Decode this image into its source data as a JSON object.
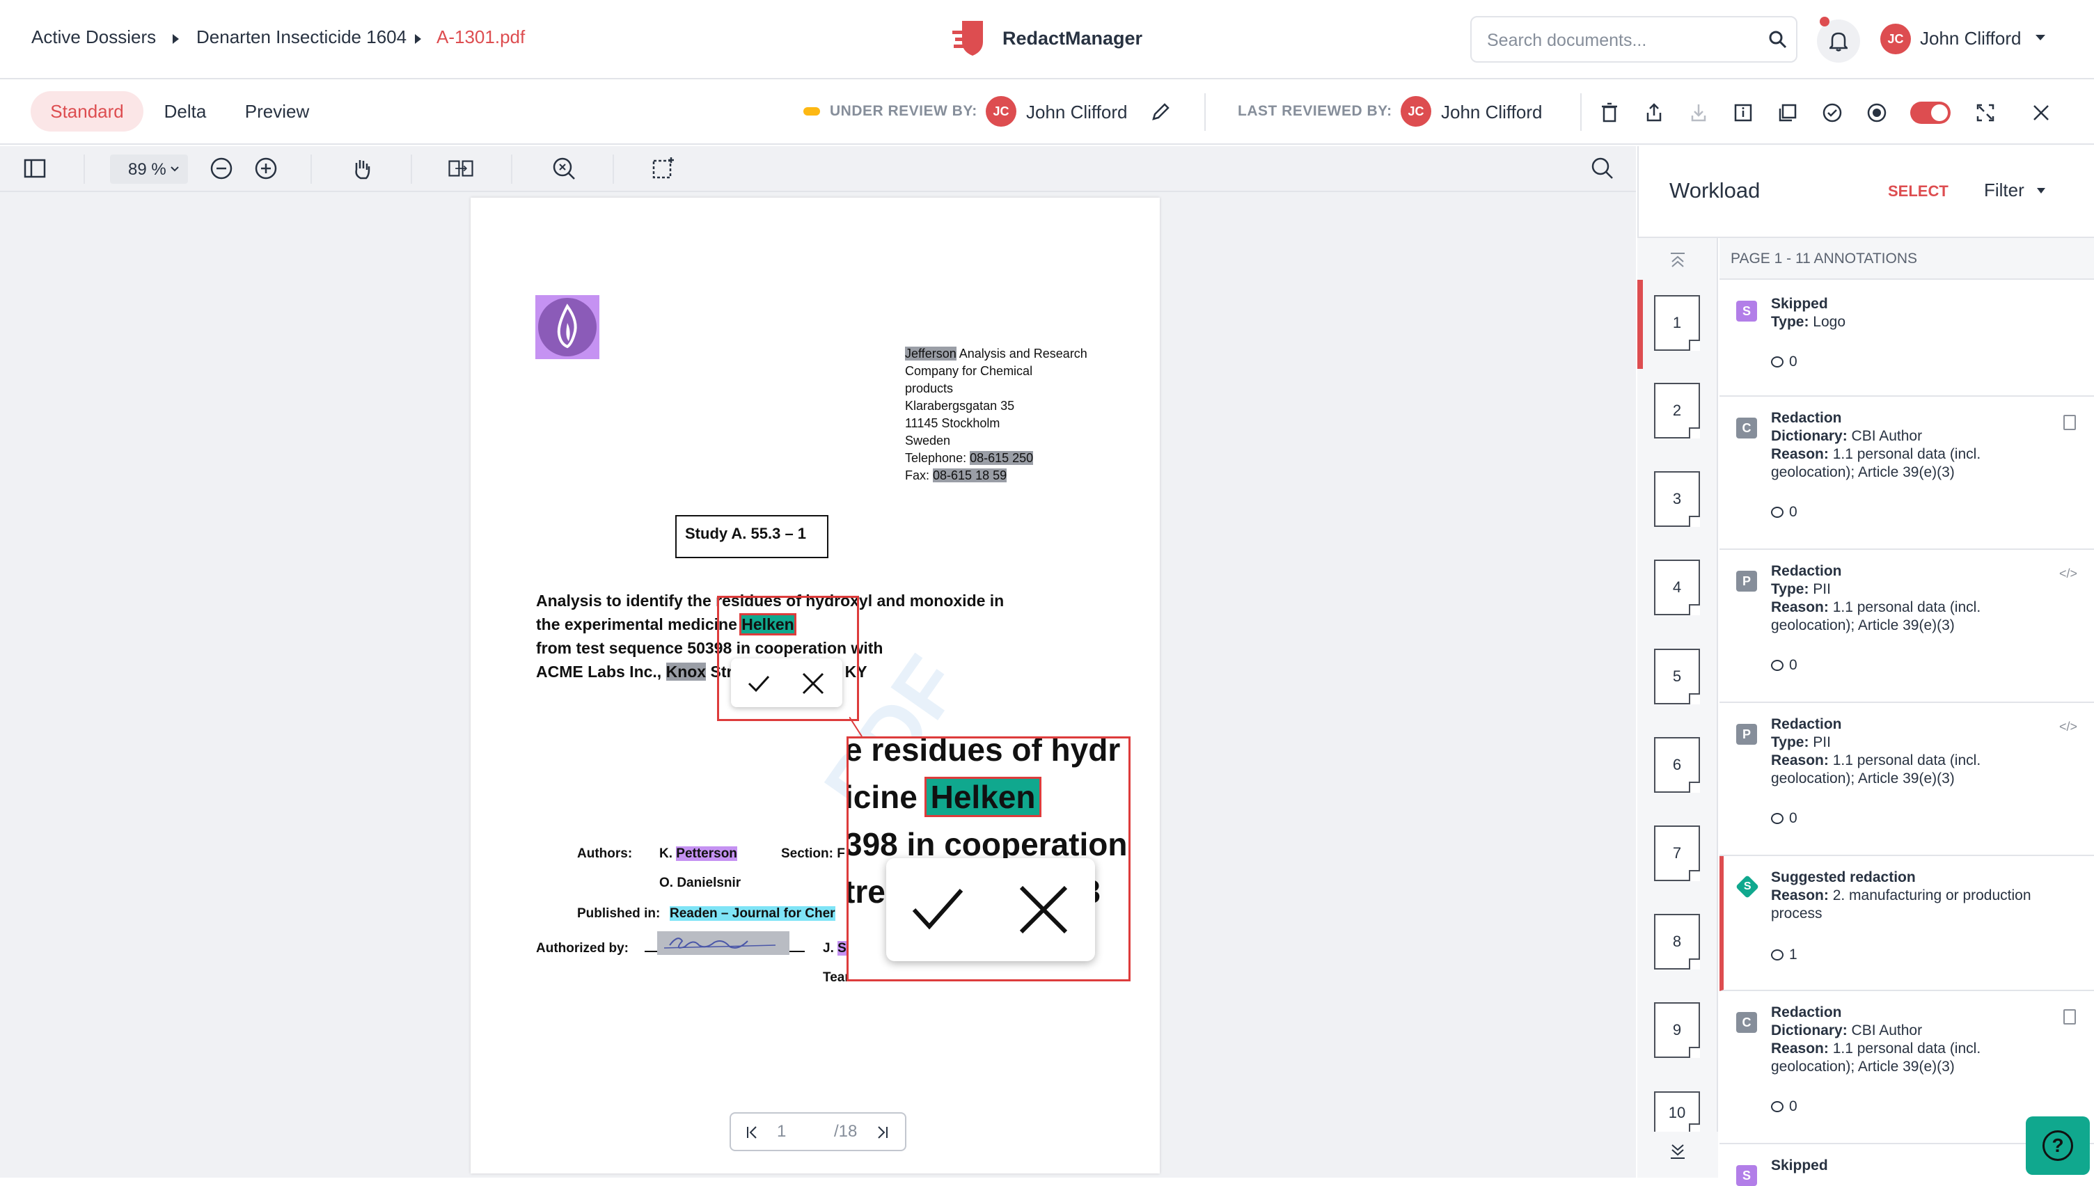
{
  "breadcrumb": {
    "item1": "Active Dossiers",
    "item2": "Denarten Insecticide 1604",
    "current": "A-1301.pdf"
  },
  "brand": {
    "name": "RedactManager"
  },
  "search": {
    "placeholder": "Search documents..."
  },
  "user": {
    "initials": "JC",
    "name": "John Clifford"
  },
  "tabs": [
    "Standard",
    "Delta",
    "Preview"
  ],
  "review": {
    "under_label": "UNDER REVIEW BY:",
    "under_initials": "JC",
    "under_name": "John Clifford",
    "last_label": "LAST REVIEWED BY:",
    "last_initials": "JC",
    "last_name": "John Clifford"
  },
  "viewer": {
    "zoom": "89 %",
    "page_current": "1",
    "page_total": "/18"
  },
  "doc": {
    "addr": [
      "Jefferson",
      " Analysis and Research",
      "Company for Chemical",
      "products",
      "Klarabergsgatan 35",
      "11145 Stockholm",
      "Sweden",
      "Telephone: ",
      "08-615 250",
      "Fax: ",
      "08-615 18 59"
    ],
    "study": "Study A. 55.3 – 1",
    "l1": "Analysis to identify the residues of hydroxyl and monoxide in",
    "l2a": "the experimental medicine ",
    "l2b": "Helken",
    "l3": "from test sequence 50398 in cooperation with",
    "l4a": "ACME Labs Inc., ",
    "l4b": "Knox",
    "l4c": " Str",
    "l4d": "337, KY",
    "authors_label": "Authors:",
    "author1a": "K. ",
    "author1b": "Petterson",
    "author2": "O. Danielsnir",
    "section": "Section: F",
    "published_label": "Published in:",
    "published": "Readen – Journal for Cher",
    "authorized_label": "Authorized by:",
    "j": "J. ",
    "js": "S",
    "team": "Team Leader",
    "zoom_l1": "e residues of hydr",
    "zoom_l2a": "icine ",
    "zoom_l2b": "Helken",
    "zoom_l3": "398 in cooperation",
    "zoom_l4": "tre",
    "zoom_l4b": "33",
    "signature": "J. Snider"
  },
  "workload": {
    "title": "Workload",
    "select": "SELECT",
    "filter": "Filter",
    "page_header": "PAGE 1 - 11 ANNOTATIONS",
    "pages": [
      "1",
      "2",
      "3",
      "4",
      "5",
      "6",
      "7",
      "8",
      "9",
      "10"
    ],
    "annotations": [
      {
        "badge": "S",
        "title": "Skipped",
        "l2k": "Type:",
        "l2v": " Logo",
        "l3k": "",
        "l3v": "",
        "l4": "",
        "comments": "0"
      },
      {
        "badge": "C",
        "title": "Redaction",
        "l2k": "Dictionary:",
        "l2v": " CBI Author",
        "l3k": "Reason:",
        "l3v": " 1.1 personal data (incl.",
        "l4": "geolocation); Article 39(e)(3)",
        "comments": "0"
      },
      {
        "badge": "P",
        "title": "Redaction",
        "l2k": "Type:",
        "l2v": " PII",
        "l3k": "Reason:",
        "l3v": " 1.1 personal data (incl.",
        "l4": "geolocation); Article 39(e)(3)",
        "comments": "0"
      },
      {
        "badge": "P",
        "title": "Redaction",
        "l2k": "Type:",
        "l2v": " PII",
        "l3k": "Reason:",
        "l3v": " 1.1 personal data (incl.",
        "l4": "geolocation); Article 39(e)(3)",
        "comments": "0"
      },
      {
        "badge": "S",
        "title": "Suggested redaction",
        "l2k": "Reason:",
        "l2v": " 2. manufacturing or production",
        "l3k": "",
        "l3v": "process",
        "l4": "",
        "comments": "1"
      },
      {
        "badge": "C",
        "title": "Redaction",
        "l2k": "Dictionary:",
        "l2v": " CBI Author",
        "l3k": "Reason:",
        "l3v": " 1.1 personal data (incl.",
        "l4": "geolocation); Article 39(e)(3)",
        "comments": "0"
      },
      {
        "badge": "S",
        "title": "Skipped",
        "l2k": "",
        "l2v": "",
        "l3k": "",
        "l3v": "",
        "l4": "",
        "comments": ""
      }
    ]
  },
  "help": {
    "label": "?"
  },
  "colors": {
    "accent": "#dd4d50",
    "skipped": "#b27ee8",
    "redaction": "#868e9a",
    "suggested": "#10a88e"
  }
}
